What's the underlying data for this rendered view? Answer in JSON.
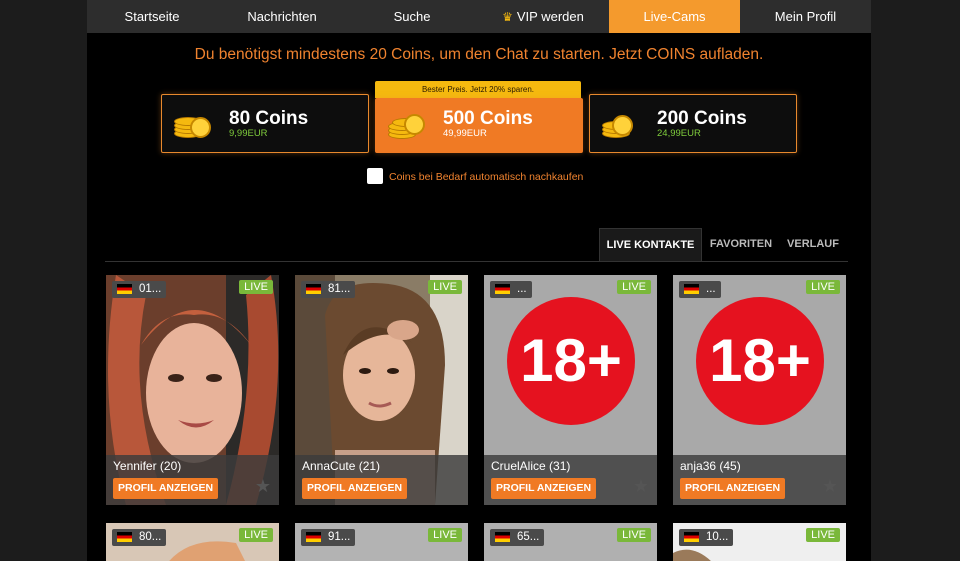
{
  "nav": {
    "items": [
      {
        "label": "Startseite"
      },
      {
        "label": "Nachrichten"
      },
      {
        "label": "Suche"
      },
      {
        "label": "VIP werden"
      },
      {
        "label": "Live-Cams"
      },
      {
        "label": "Mein Profil"
      }
    ]
  },
  "notice": "Du benötigst mindestens 20 Coins, um den Chat zu starten. Jetzt COINS aufladen.",
  "packages": [
    {
      "title": "80 Coins",
      "price": "9,99EUR"
    },
    {
      "title": "500 Coins",
      "price": "49,99EUR",
      "banner": "Bester Preis. Jetzt 20% sparen."
    },
    {
      "title": "200 Coins",
      "price": "24,99EUR"
    }
  ],
  "auto_buy_label": "Coins bei Bedarf automatisch nachkaufen",
  "tabs": [
    {
      "label": "LIVE KONTAKTE"
    },
    {
      "label": "FAVORITEN"
    },
    {
      "label": "VERLAUF"
    }
  ],
  "cards": [
    {
      "badge": "01...",
      "live": "LIVE",
      "name": "Yennifer (20)",
      "button": "PROFIL ANZEIGEN",
      "age_icon": ""
    },
    {
      "badge": "81...",
      "live": "LIVE",
      "name": "AnnaCute (21)",
      "button": "PROFIL ANZEIGEN",
      "age_icon": ""
    },
    {
      "badge": "...",
      "live": "LIVE",
      "name": "CruelAlice (31)",
      "button": "PROFIL ANZEIGEN",
      "age_icon": "18+"
    },
    {
      "badge": "...",
      "live": "LIVE",
      "name": "anja36 (45)",
      "button": "PROFIL ANZEIGEN",
      "age_icon": "18+"
    }
  ],
  "cards_row2": [
    {
      "badge": "80...",
      "live": "LIVE"
    },
    {
      "badge": "91...",
      "live": "LIVE"
    },
    {
      "badge": "65...",
      "live": "LIVE"
    },
    {
      "badge": "10...",
      "live": "LIVE"
    }
  ],
  "colors": {
    "accent": "#f07a24",
    "live": "#7ab83a",
    "coin": "#f5b90f",
    "alert": "#e5121f"
  },
  "icons": [
    "crown-icon",
    "coins-icon",
    "flag-de-icon",
    "star-icon"
  ]
}
